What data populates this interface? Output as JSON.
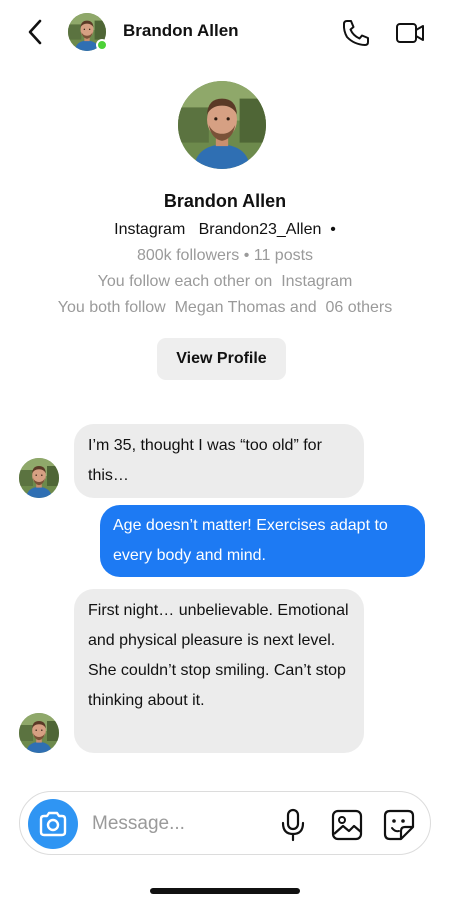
{
  "header": {
    "name": "Brandon Allen",
    "back_icon": "chevron-left-icon",
    "call_icon": "phone-icon",
    "video_icon": "video-camera-icon",
    "online_color": "#4cd137"
  },
  "profile": {
    "name": "Brandon Allen",
    "handle_line": "Instagram   Brandon23_Allen  •",
    "stats_line": "800k followers • 11 posts",
    "follow_line": "You follow each other on  Instagram",
    "mutual_line": "You both follow  Megan Thomas and  06 others",
    "view_profile_label": "View Profile"
  },
  "messages": [
    {
      "direction": "incoming",
      "text": "I’m 35, thought I was “too old” for this…"
    },
    {
      "direction": "outgoing",
      "text": "Age doesn’t matter! Exercises adapt to every body and mind."
    },
    {
      "direction": "incoming",
      "text": "First night… unbelievable. Emotional and physical pleasure is next level. She couldn’t stop smiling. Can’t stop thinking about it."
    }
  ],
  "composer": {
    "placeholder": "Message...",
    "camera_icon": "camera-icon",
    "mic_icon": "microphone-icon",
    "gallery_icon": "image-icon",
    "sticker_icon": "sticker-icon"
  },
  "colors": {
    "outgoing_bubble": "#1d7af3",
    "incoming_bubble": "#ececec",
    "camera_button": "#2f95f3"
  }
}
